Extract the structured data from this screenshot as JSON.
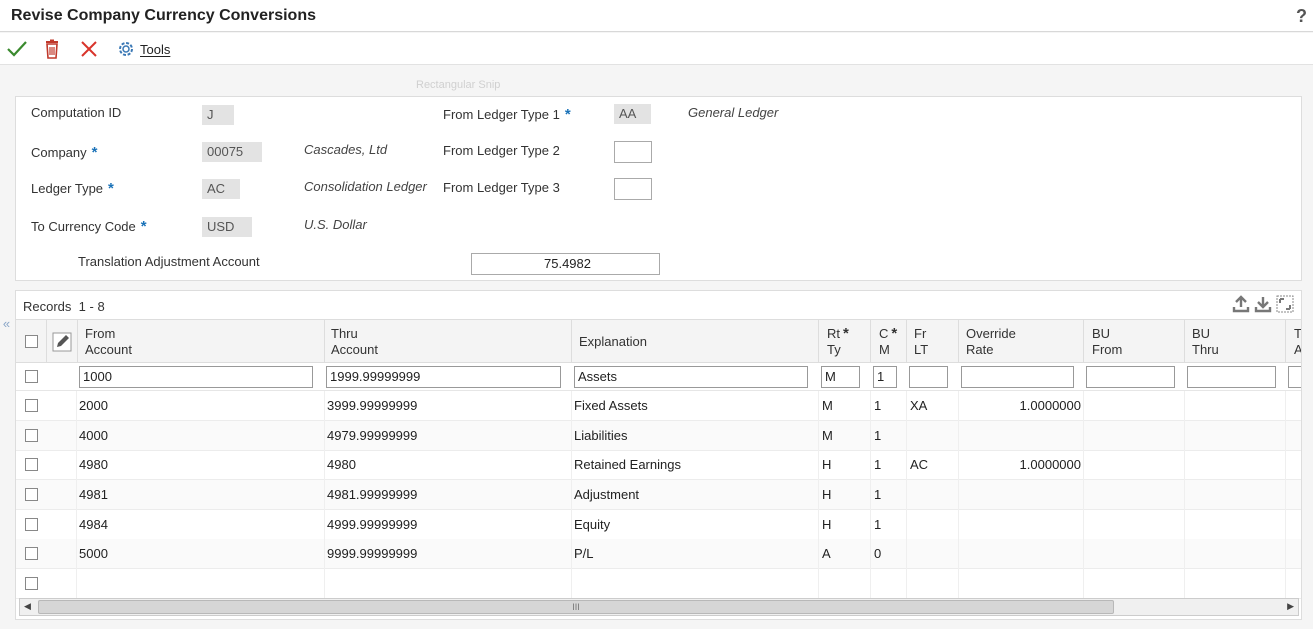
{
  "window": {
    "title": "Revise Company Currency Conversions",
    "help": "?"
  },
  "toolbar": {
    "ok_icon": "checkmark-icon",
    "delete_icon": "trash-icon",
    "cancel_icon": "close-icon",
    "tools_label": "Tools"
  },
  "ghost_text": "Rectangular Snip",
  "header": {
    "computation_id": {
      "label": "Computation ID",
      "value": "J"
    },
    "company": {
      "label": "Company",
      "value": "00075",
      "description": "Cascades, Ltd"
    },
    "ledger_type": {
      "label": "Ledger Type",
      "value": "AC",
      "description": "Consolidation Ledger"
    },
    "to_currency": {
      "label": "To Currency Code",
      "value": "USD",
      "description": "U.S. Dollar"
    },
    "translation_adj": {
      "label": "Translation Adjustment Account",
      "value": "75.4982"
    },
    "from_lt1": {
      "label": "From Ledger Type 1",
      "value": "AA",
      "description": "General Ledger"
    },
    "from_lt2": {
      "label": "From Ledger Type 2",
      "value": ""
    },
    "from_lt3": {
      "label": "From Ledger Type 3",
      "value": ""
    },
    "required_mark": "*"
  },
  "grid": {
    "records_label": "Records",
    "records_range": "1 - 8",
    "collapse_glyph": "«",
    "columns": {
      "from1": "From",
      "from2": "Account",
      "thru1": "Thru",
      "thru2": "Account",
      "explanation": "Explanation",
      "rt1": "Rt",
      "rt2": "Ty",
      "cm1": "C",
      "cm2": "M",
      "fr1": "Fr",
      "fr2": "LT",
      "ov1": "Override",
      "ov2": "Rate",
      "buf1": "BU",
      "buf2": "From",
      "but1": "BU",
      "but2": "Thru",
      "trunc1": "Tr",
      "trunc2": "A",
      "star": "*"
    },
    "qbe": {
      "from": "1000",
      "thru": "1999.99999999",
      "explanation": "Assets",
      "rt": "M",
      "cm": "1",
      "fr": "",
      "ov": "",
      "buf": "",
      "but": ""
    },
    "rows": [
      {
        "from": "2000",
        "thru": "3999.99999999",
        "explanation": "Fixed Assets",
        "rt": "M",
        "cm": "1",
        "fr": "XA",
        "ov": "1.0000000"
      },
      {
        "from": "4000",
        "thru": "4979.99999999",
        "explanation": "Liabilities",
        "rt": "M",
        "cm": "1",
        "fr": "",
        "ov": ""
      },
      {
        "from": "4980",
        "thru": "4980",
        "explanation": "Retained Earnings",
        "rt": "H",
        "cm": "1",
        "fr": "AC",
        "ov": "1.0000000"
      },
      {
        "from": "4981",
        "thru": "4981.99999999",
        "explanation": "Adjustment",
        "rt": "H",
        "cm": "1",
        "fr": "",
        "ov": ""
      },
      {
        "from": "4984",
        "thru": "4999.99999999",
        "explanation": "Equity",
        "rt": "H",
        "cm": "1",
        "fr": "",
        "ov": ""
      },
      {
        "from": "5000",
        "thru": "9999.99999999",
        "explanation": "P/L",
        "rt": "A",
        "cm": "0",
        "fr": "",
        "ov": ""
      }
    ],
    "scroll_grip": "III",
    "scroll_left": "◀",
    "scroll_right": "▶"
  }
}
